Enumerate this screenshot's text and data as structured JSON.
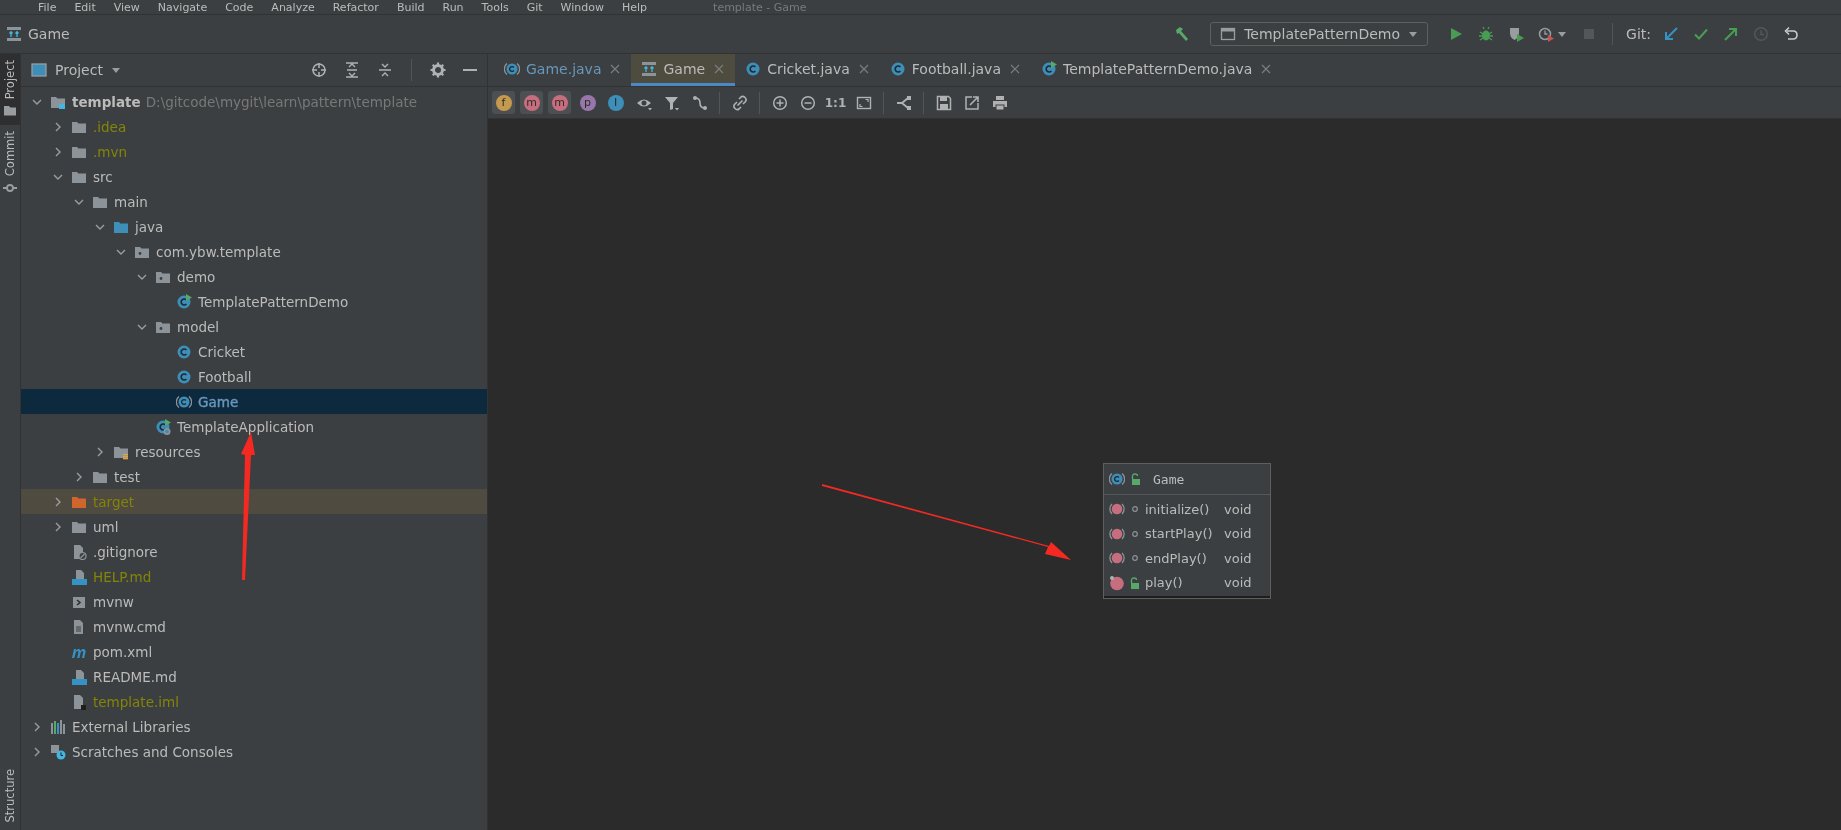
{
  "menu_bar": {
    "items": [
      "File",
      "Edit",
      "View",
      "Navigate",
      "Code",
      "Analyze",
      "Refactor",
      "Build",
      "Run",
      "Tools",
      "Git",
      "Window",
      "Help"
    ],
    "title": "template - Game"
  },
  "nav_bar": {
    "breadcrumb": "Game",
    "toolbar": [
      {
        "kind": "build",
        "disabled": false
      },
      {
        "kind": "run-config",
        "label": "TemplatePatternDemo",
        "disabled": false
      },
      {
        "kind": "run",
        "disabled": false
      },
      {
        "kind": "debug",
        "disabled": false
      },
      {
        "kind": "coverage",
        "disabled": false
      },
      {
        "kind": "profile",
        "disabled": false
      },
      {
        "kind": "stop",
        "disabled": true
      },
      {
        "kind": "git-label",
        "label": "Git:",
        "disabled": false
      },
      {
        "kind": "update",
        "disabled": false
      },
      {
        "kind": "commit",
        "disabled": false
      },
      {
        "kind": "push",
        "disabled": false
      },
      {
        "kind": "history",
        "disabled": true
      },
      {
        "kind": "rollback",
        "disabled": false
      }
    ]
  },
  "side_stripe": {
    "top": [
      {
        "label": "Project",
        "kind": "project",
        "selected": true
      },
      {
        "label": "Commit",
        "kind": "commit",
        "selected": false
      }
    ],
    "bottom": [
      {
        "label": "Structure",
        "selected": false
      }
    ]
  },
  "project_panel": {
    "title": "Project",
    "tree": [
      {
        "label": "template",
        "hint": "D:\\gitcode\\mygit\\learn\\pattern\\template",
        "kind": "project",
        "color": "#bbbbbb",
        "expanded": true,
        "selected": false,
        "children": [
          {
            "label": ".idea",
            "kind": "folder",
            "color": "#848504",
            "expanded": false,
            "selected": false
          },
          {
            "label": ".mvn",
            "kind": "folder",
            "color": "#848504",
            "expanded": false,
            "selected": false
          },
          {
            "label": "src",
            "kind": "folder",
            "color": "#bbbbbb",
            "expanded": true,
            "selected": false,
            "children": [
              {
                "label": "main",
                "kind": "folder",
                "color": "#bbbbbb",
                "expanded": true,
                "selected": false,
                "children": [
                  {
                    "label": "java",
                    "kind": "source-folder",
                    "color": "#bbbbbb",
                    "expanded": true,
                    "selected": false,
                    "children": [
                      {
                        "label": "com.ybw.template",
                        "kind": "package",
                        "color": "#bbbbbb",
                        "expanded": true,
                        "selected": false,
                        "children": [
                          {
                            "label": "demo",
                            "kind": "package",
                            "color": "#bbbbbb",
                            "expanded": true,
                            "selected": false,
                            "children": [
                              {
                                "label": "TemplatePatternDemo",
                                "kind": "runnable-class",
                                "color": "#bbbbbb",
                                "selected": false
                              }
                            ]
                          },
                          {
                            "label": "model",
                            "kind": "package",
                            "color": "#bbbbbb",
                            "expanded": true,
                            "selected": false,
                            "children": [
                              {
                                "label": "Cricket",
                                "kind": "class",
                                "color": "#bbbbbb",
                                "selected": false
                              },
                              {
                                "label": "Football",
                                "kind": "class",
                                "color": "#bbbbbb",
                                "selected": false
                              },
                              {
                                "label": "Game",
                                "kind": "abstract-class",
                                "color": "#6897bb",
                                "selected": true
                              }
                            ]
                          },
                          {
                            "label": "TemplateApplication",
                            "kind": "spring-class",
                            "color": "#bbbbbb",
                            "selected": false
                          }
                        ]
                      }
                    ]
                  },
                  {
                    "label": "resources",
                    "kind": "resources-folder",
                    "color": "#bbbbbb",
                    "expanded": false,
                    "selected": false
                  }
                ]
              },
              {
                "label": "test",
                "kind": "folder",
                "color": "#bbbbbb",
                "expanded": false,
                "selected": false
              }
            ]
          },
          {
            "label": "target",
            "kind": "excluded-folder",
            "color": "#848504",
            "expanded": false,
            "selected": false
          },
          {
            "label": "uml",
            "kind": "folder",
            "color": "#bbbbbb",
            "expanded": false,
            "selected": false
          },
          {
            "label": ".gitignore",
            "kind": "ignore-file",
            "color": "#bbbbbb",
            "selected": false
          },
          {
            "label": "HELP.md",
            "kind": "markdown",
            "color": "#848504",
            "selected": false
          },
          {
            "label": "mvnw",
            "kind": "script",
            "color": "#bbbbbb",
            "selected": false
          },
          {
            "label": "mvnw.cmd",
            "kind": "text-file",
            "color": "#bbbbbb",
            "selected": false
          },
          {
            "label": "pom.xml",
            "kind": "maven",
            "color": "#bbbbbb",
            "selected": false
          },
          {
            "label": "README.md",
            "kind": "markdown",
            "color": "#bbbbbb",
            "selected": false
          },
          {
            "label": "template.iml",
            "kind": "module-file",
            "color": "#848504",
            "selected": false
          }
        ]
      },
      {
        "label": "External Libraries",
        "kind": "libraries",
        "color": "#bbbbbb",
        "expanded": false,
        "selected": false
      },
      {
        "label": "Scratches and Consoles",
        "kind": "scratches",
        "color": "#bbbbbb",
        "expanded": false,
        "selected": false
      }
    ]
  },
  "editor": {
    "tabs": [
      {
        "label": "Game.java",
        "kind": "abstract-class",
        "color": "#6897bb",
        "selected": false
      },
      {
        "label": "Game",
        "kind": "diagram",
        "color": "#bbbbbb",
        "selected": true
      },
      {
        "label": "Cricket.java",
        "kind": "class",
        "color": "#bbbbbb",
        "selected": false
      },
      {
        "label": "Football.java",
        "kind": "class",
        "color": "#bbbbbb",
        "selected": false
      },
      {
        "label": "TemplatePatternDemo.java",
        "kind": "runnable-class",
        "color": "#bbbbbb",
        "selected": false
      }
    ],
    "diagram_toolbar": [
      {
        "kind": "toggle",
        "glyph": "f",
        "color": "#c69a4e",
        "on": true
      },
      {
        "kind": "toggle",
        "glyph": "m",
        "color": "#c76e7e",
        "on": true
      },
      {
        "kind": "toggle",
        "glyph": "m",
        "color": "#c76e7e",
        "on": true
      },
      {
        "kind": "toggle",
        "glyph": "p",
        "color": "#9876aa",
        "on": false
      },
      {
        "kind": "toggle",
        "glyph": "I",
        "color": "#3d8eb9",
        "on": false
      },
      {
        "kind": "visibility"
      },
      {
        "kind": "filter"
      },
      {
        "kind": "edge"
      },
      {
        "kind": "separator"
      },
      {
        "kind": "link"
      },
      {
        "kind": "separator"
      },
      {
        "kind": "zoom-in"
      },
      {
        "kind": "zoom-out"
      },
      {
        "kind": "actual-size",
        "label": "1:1"
      },
      {
        "kind": "fit"
      },
      {
        "kind": "separator"
      },
      {
        "kind": "layout"
      },
      {
        "kind": "separator"
      },
      {
        "kind": "save"
      },
      {
        "kind": "export"
      },
      {
        "kind": "print"
      }
    ],
    "diagram": {
      "class": {
        "name": "Game",
        "methods": [
          {
            "name": "initialize()",
            "type": "void",
            "public": false,
            "abstract": true
          },
          {
            "name": "startPlay()",
            "type": "void",
            "public": false,
            "abstract": true
          },
          {
            "name": "endPlay()",
            "type": "void",
            "public": false,
            "abstract": true
          },
          {
            "name": "play()",
            "type": "void",
            "public": true,
            "abstract": false
          }
        ]
      }
    }
  }
}
